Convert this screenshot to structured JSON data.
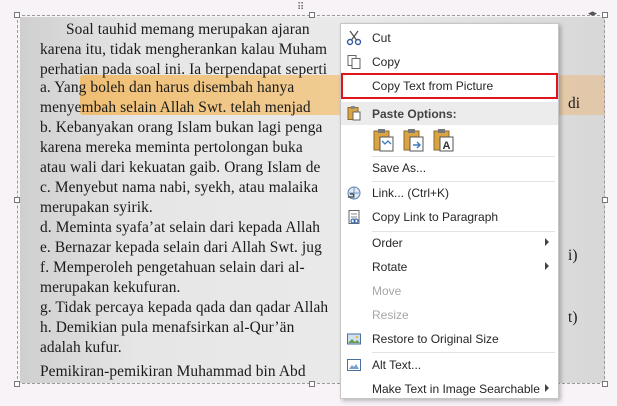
{
  "document": {
    "lines": [
      "Soal tauhid memang merupakan ajaran",
      "karena itu, tidak mengherankan kalau Muham",
      "perhatian pada soal ini. Ia berpendapat seperti",
      "a.  Yang boleh dan harus disembah hanya",
      "     menyembah selain Allah Swt. telah menjad",
      "b.  Kebanyakan orang Islam bukan lagi penga",
      "     karena mereka meminta pertolongan buka",
      "     atau wali dari kekuatan gaib. Orang Islam de",
      "c.  Menyebut nama nabi, syekh, atau malaika",
      "     merupakan syirik.",
      "d.  Meminta syafa’at selain dari kepada Allah",
      "e.  Bernazar kepada selain dari Allah Swt. jug",
      "f.   Memperoleh pengetahuan selain dari al-",
      "     merupakan kekufuran.",
      "g.  Tidak percaya kepada qada dan qadar Allah",
      "h.  Demikian pula menafsirkan al-Qur’än",
      "     adalah kufur.",
      "     Pemikiran-pemikiran Muhammad bin Abd"
    ],
    "right_fragments": [
      "di",
      "i)",
      "t)"
    ]
  },
  "menu": {
    "cut": "Cut",
    "copy": "Copy",
    "copy_text_from_picture": "Copy Text from Picture",
    "paste_options": "Paste Options:",
    "save_as": "Save As...",
    "link": "Link...  (Ctrl+K)",
    "copy_link_to_paragraph": "Copy Link to Paragraph",
    "order": "Order",
    "rotate": "Rotate",
    "move": "Move",
    "resize": "Resize",
    "restore": "Restore to Original Size",
    "alt_text": "Alt Text...",
    "make_searchable": "Make Text in Image Searchable"
  },
  "colors": {
    "highlight_outline": "#e0141b",
    "document_highlight": "#f5b450"
  },
  "icons": {
    "cut": "scissors-icon",
    "copy": "copy-icon",
    "paste": "clipboard-icon",
    "link": "link-icon",
    "copy_link": "document-link-icon",
    "restore": "image-restore-icon",
    "alt_text": "alt-text-icon"
  }
}
